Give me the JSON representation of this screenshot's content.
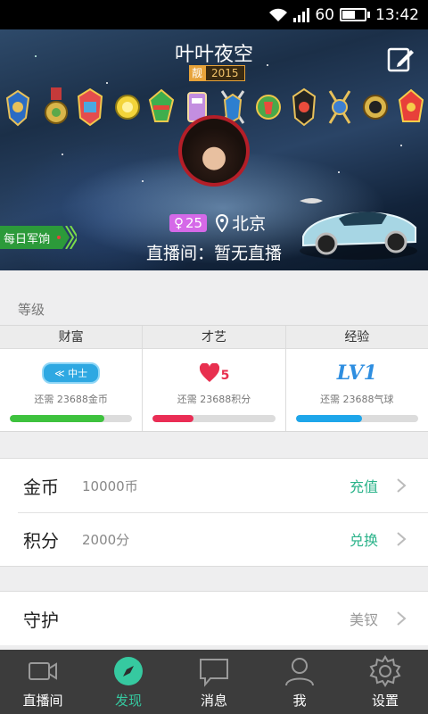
{
  "status_bar": {
    "battery_percent": "60",
    "battery_level": 0.6,
    "time": "13:42"
  },
  "profile": {
    "name": "叶叶夜空",
    "title_badge": {
      "mark": "靓",
      "year": "2015"
    },
    "gender_age": "25",
    "gender_symbol": "♀",
    "location": "北京",
    "live_status": "直播间：暂无直播",
    "daily_button": "每日军饷"
  },
  "level": {
    "section_title": "等级",
    "columns": [
      {
        "header": "财富",
        "badge_text": "中士",
        "note": "还需 23688金币",
        "progress": 0.77,
        "bar_color": "#3ec23e"
      },
      {
        "header": "才艺",
        "badge_text": "5",
        "note": "还需 23688积分",
        "progress": 0.33,
        "bar_color": "#ea2d55"
      },
      {
        "header": "经验",
        "badge_text": "LV1",
        "note": "还需 23688气球",
        "progress": 0.54,
        "bar_color": "#1ea6ea"
      }
    ]
  },
  "wallet": [
    {
      "label": "金币",
      "value": "10000币",
      "action": "充值"
    },
    {
      "label": "积分",
      "value": "2000分",
      "action": "兑换"
    }
  ],
  "guard": {
    "label": "守护",
    "value": "美钗"
  },
  "colors": {
    "accent": "#2bb38a",
    "tabbar_bg": "#3c3c3c",
    "active_tab": "#36c9a0"
  },
  "tabs": [
    {
      "label": "直播间",
      "icon": "video-camera-icon",
      "active": false
    },
    {
      "label": "发现",
      "icon": "compass-icon",
      "active": true
    },
    {
      "label": "消息",
      "icon": "message-bubble-icon",
      "active": false
    },
    {
      "label": "我",
      "icon": "person-icon",
      "active": false
    },
    {
      "label": "设置",
      "icon": "gear-icon",
      "active": false
    }
  ]
}
